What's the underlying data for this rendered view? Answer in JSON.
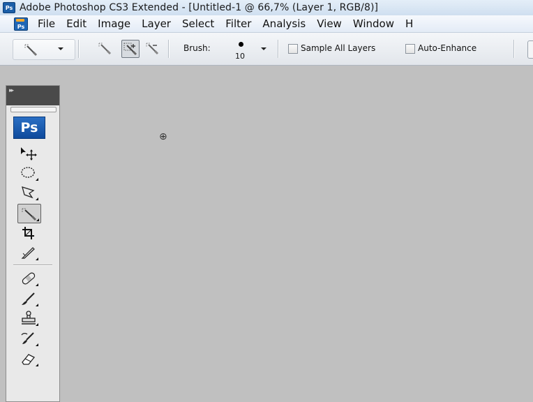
{
  "titlebar": {
    "app_badge": "Ps",
    "title": "Adobe Photoshop CS3 Extended - [Untitled-1 @ 66,7% (Layer 1, RGB/8)]"
  },
  "menubar": {
    "app_icon": "Ps",
    "items": [
      "File",
      "Edit",
      "Image",
      "Layer",
      "Select",
      "Filter",
      "Analysis",
      "View",
      "Window",
      "H"
    ]
  },
  "options_bar": {
    "brush_label": "Brush:",
    "brush_size": "10",
    "sample_all_layers_label": "Sample All Layers",
    "sample_all_layers_checked": false,
    "auto_enhance_label": "Auto-Enhance",
    "auto_enhance_checked": false
  },
  "toolbox": {
    "logo": "Ps",
    "tools": [
      {
        "name": "move-tool",
        "icon": "move-icon"
      },
      {
        "name": "marquee-tool",
        "icon": "elliptical-marquee-icon"
      },
      {
        "name": "lasso-tool",
        "icon": "polygonal-lasso-icon"
      },
      {
        "name": "quick-selection-tool",
        "icon": "quick-selection-icon",
        "active": true
      },
      {
        "name": "crop-tool",
        "icon": "crop-icon"
      },
      {
        "name": "slice-tool",
        "icon": "slice-icon"
      },
      {
        "name": "healing-brush-tool",
        "icon": "bandage-icon"
      },
      {
        "name": "brush-tool",
        "icon": "brush-icon"
      },
      {
        "name": "clone-stamp-tool",
        "icon": "stamp-icon"
      },
      {
        "name": "history-brush-tool",
        "icon": "history-brush-icon"
      },
      {
        "name": "eraser-tool",
        "icon": "eraser-icon"
      }
    ]
  },
  "canvas": {
    "background_color": "#c0c0c0",
    "cursor": "quick-selection-cursor-icon"
  }
}
